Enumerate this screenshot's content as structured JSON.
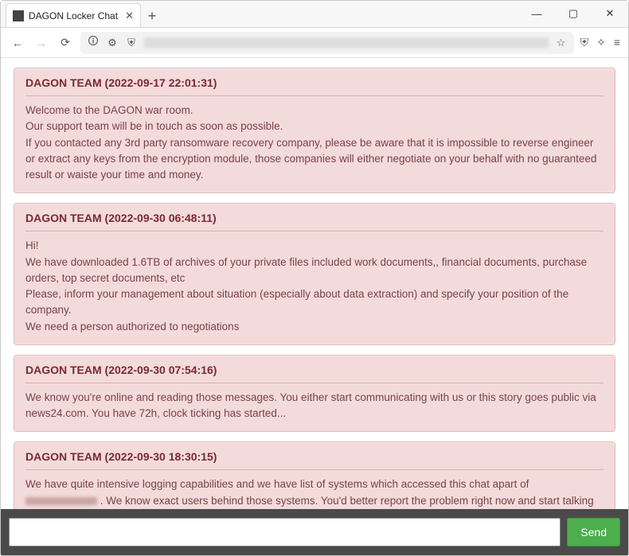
{
  "window": {
    "tab_title": "DAGON Locker Chat",
    "minimize": "—",
    "maximize": "▢",
    "close": "✕",
    "newtab": "+"
  },
  "toolbar": {
    "back": "←",
    "forward": "→",
    "reload": "⟳",
    "security": "🛈",
    "settings": "⚙",
    "shield": "⛨",
    "star": "☆",
    "ext": "✧",
    "menu": "≡"
  },
  "messages": [
    {
      "author": "DAGON TEAM",
      "timestamp": "2022-09-17 22:01:31",
      "body": "Welcome to the DAGON war room.\nOur support team will be in touch as soon as possible.\nIf you contacted any 3rd party ransomware recovery company, please be aware that it is impossible to reverse engineer or extract any keys from the encryption module, those companies will either negotiate on your behalf with no guaranteed result or waiste your time and money."
    },
    {
      "author": "DAGON TEAM",
      "timestamp": "2022-09-30 06:48:11",
      "body": "Hi!\nWe have downloaded 1.6TB of archives of your private files included work documents,, financial documents, purchase orders, top secret documents, etc\nPlease, inform your management about situation (especially about data extraction) and specify your position of the company.\nWe need a person authorized to negotiations"
    },
    {
      "author": "DAGON TEAM",
      "timestamp": "2022-09-30 07:54:16",
      "body": "We know you're online and reading those messages. You either start communicating with us or this story goes public via news24.com. You have 72h, clock ticking has started..."
    },
    {
      "author": "DAGON TEAM",
      "timestamp": "2022-09-30 18:30:15",
      "body_pre": "We have quite intensive logging capabilities and we have list of systems which accessed this chat apart of ",
      "body_post": " . We know exact users behind those systems. You'd better report the problem right now and start talking here, otherwise your superior commanders will get known exact names of those who were aware of the data leak but didn't act properly"
    }
  ],
  "footer": {
    "input_placeholder": "",
    "send_label": "Send"
  }
}
